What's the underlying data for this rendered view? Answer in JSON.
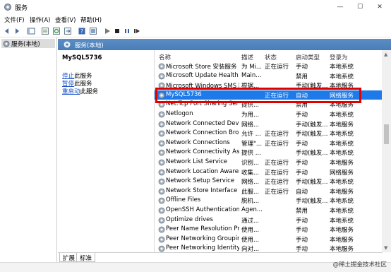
{
  "window": {
    "title": "服务"
  },
  "menu": [
    "文件(F)",
    "操作(A)",
    "查看(V)",
    "帮助(H)"
  ],
  "tree": {
    "root_label": "服务(本地)"
  },
  "header": {
    "label": "服务(本地)"
  },
  "detail": {
    "service_name": "MySQL5736",
    "actions": [
      {
        "link": "停止",
        "suffix": "此服务"
      },
      {
        "link": "暂停",
        "suffix": "此服务"
      },
      {
        "link": "重启动",
        "suffix": "此服务"
      }
    ]
  },
  "columns": [
    "名称",
    "描述",
    "状态",
    "启动类型",
    "登录为"
  ],
  "rows": [
    {
      "name": "Microsoft Store 安装服务",
      "desc": "为 Mi...",
      "state": "正在运行",
      "start": "手动",
      "login": "本地系统"
    },
    {
      "name": "Microsoft Update Health S...",
      "desc": "Main...",
      "state": "",
      "start": "禁用",
      "login": "本地系统"
    },
    {
      "name": "Microsoft Windows SMS 路...",
      "desc": "根据...",
      "state": "",
      "start": "手动(触发...",
      "login": "本地服务"
    },
    {
      "name": "MySQL5736",
      "desc": "",
      "state": "正在运行",
      "start": "自动",
      "login": "网络服务",
      "selected": true
    },
    {
      "name": "Net.Tcp Port Sharing Service",
      "desc": "提供...",
      "state": "",
      "start": "禁用",
      "login": "本地服务"
    },
    {
      "name": "Netlogon",
      "desc": "为用...",
      "state": "",
      "start": "手动",
      "login": "本地系统"
    },
    {
      "name": "Network Connected Devic...",
      "desc": "网络...",
      "state": "",
      "start": "手动(触发...",
      "login": "本地服务"
    },
    {
      "name": "Network Connection Broker",
      "desc": "允许 ...",
      "state": "正在运行",
      "start": "手动(触发...",
      "login": "本地系统"
    },
    {
      "name": "Network Connections",
      "desc": "管理\"...",
      "state": "正在运行",
      "start": "手动",
      "login": "本地系统"
    },
    {
      "name": "Network Connectivity Assis...",
      "desc": "提供 ...",
      "state": "",
      "start": "手动(触发...",
      "login": "本地系统"
    },
    {
      "name": "Network List Service",
      "desc": "识别...",
      "state": "正在运行",
      "start": "手动",
      "login": "本地服务"
    },
    {
      "name": "Network Location Awarene...",
      "desc": "收集...",
      "state": "正在运行",
      "start": "手动",
      "login": "网络服务"
    },
    {
      "name": "Network Setup Service",
      "desc": "网络...",
      "state": "正在运行",
      "start": "手动(触发...",
      "login": "本地系统"
    },
    {
      "name": "Network Store Interface Se...",
      "desc": "此服...",
      "state": "正在运行",
      "start": "自动",
      "login": "本地服务"
    },
    {
      "name": "Offline Files",
      "desc": "脱机...",
      "state": "",
      "start": "手动(触发...",
      "login": "本地系统"
    },
    {
      "name": "OpenSSH Authentication ...",
      "desc": "Agen...",
      "state": "",
      "start": "禁用",
      "login": "本地系统"
    },
    {
      "name": "Optimize drives",
      "desc": "通过...",
      "state": "",
      "start": "手动",
      "login": "本地系统"
    },
    {
      "name": "Peer Name Resolution Pro...",
      "desc": "使用...",
      "state": "",
      "start": "手动",
      "login": "本地服务"
    },
    {
      "name": "Peer Networking Grouping",
      "desc": "使用...",
      "state": "",
      "start": "手动",
      "login": "本地服务"
    },
    {
      "name": "Peer Networking Identity ...",
      "desc": "向对...",
      "state": "",
      "start": "手动",
      "login": "本地服务"
    }
  ],
  "tabs": [
    "扩展",
    "标准"
  ],
  "watermark": "@稀土掘金技术社区",
  "colors": {
    "selection": "#1e7ae8",
    "header_band": "#4b7db8",
    "highlight_border": "#e00000",
    "link": "#1a53c8"
  }
}
